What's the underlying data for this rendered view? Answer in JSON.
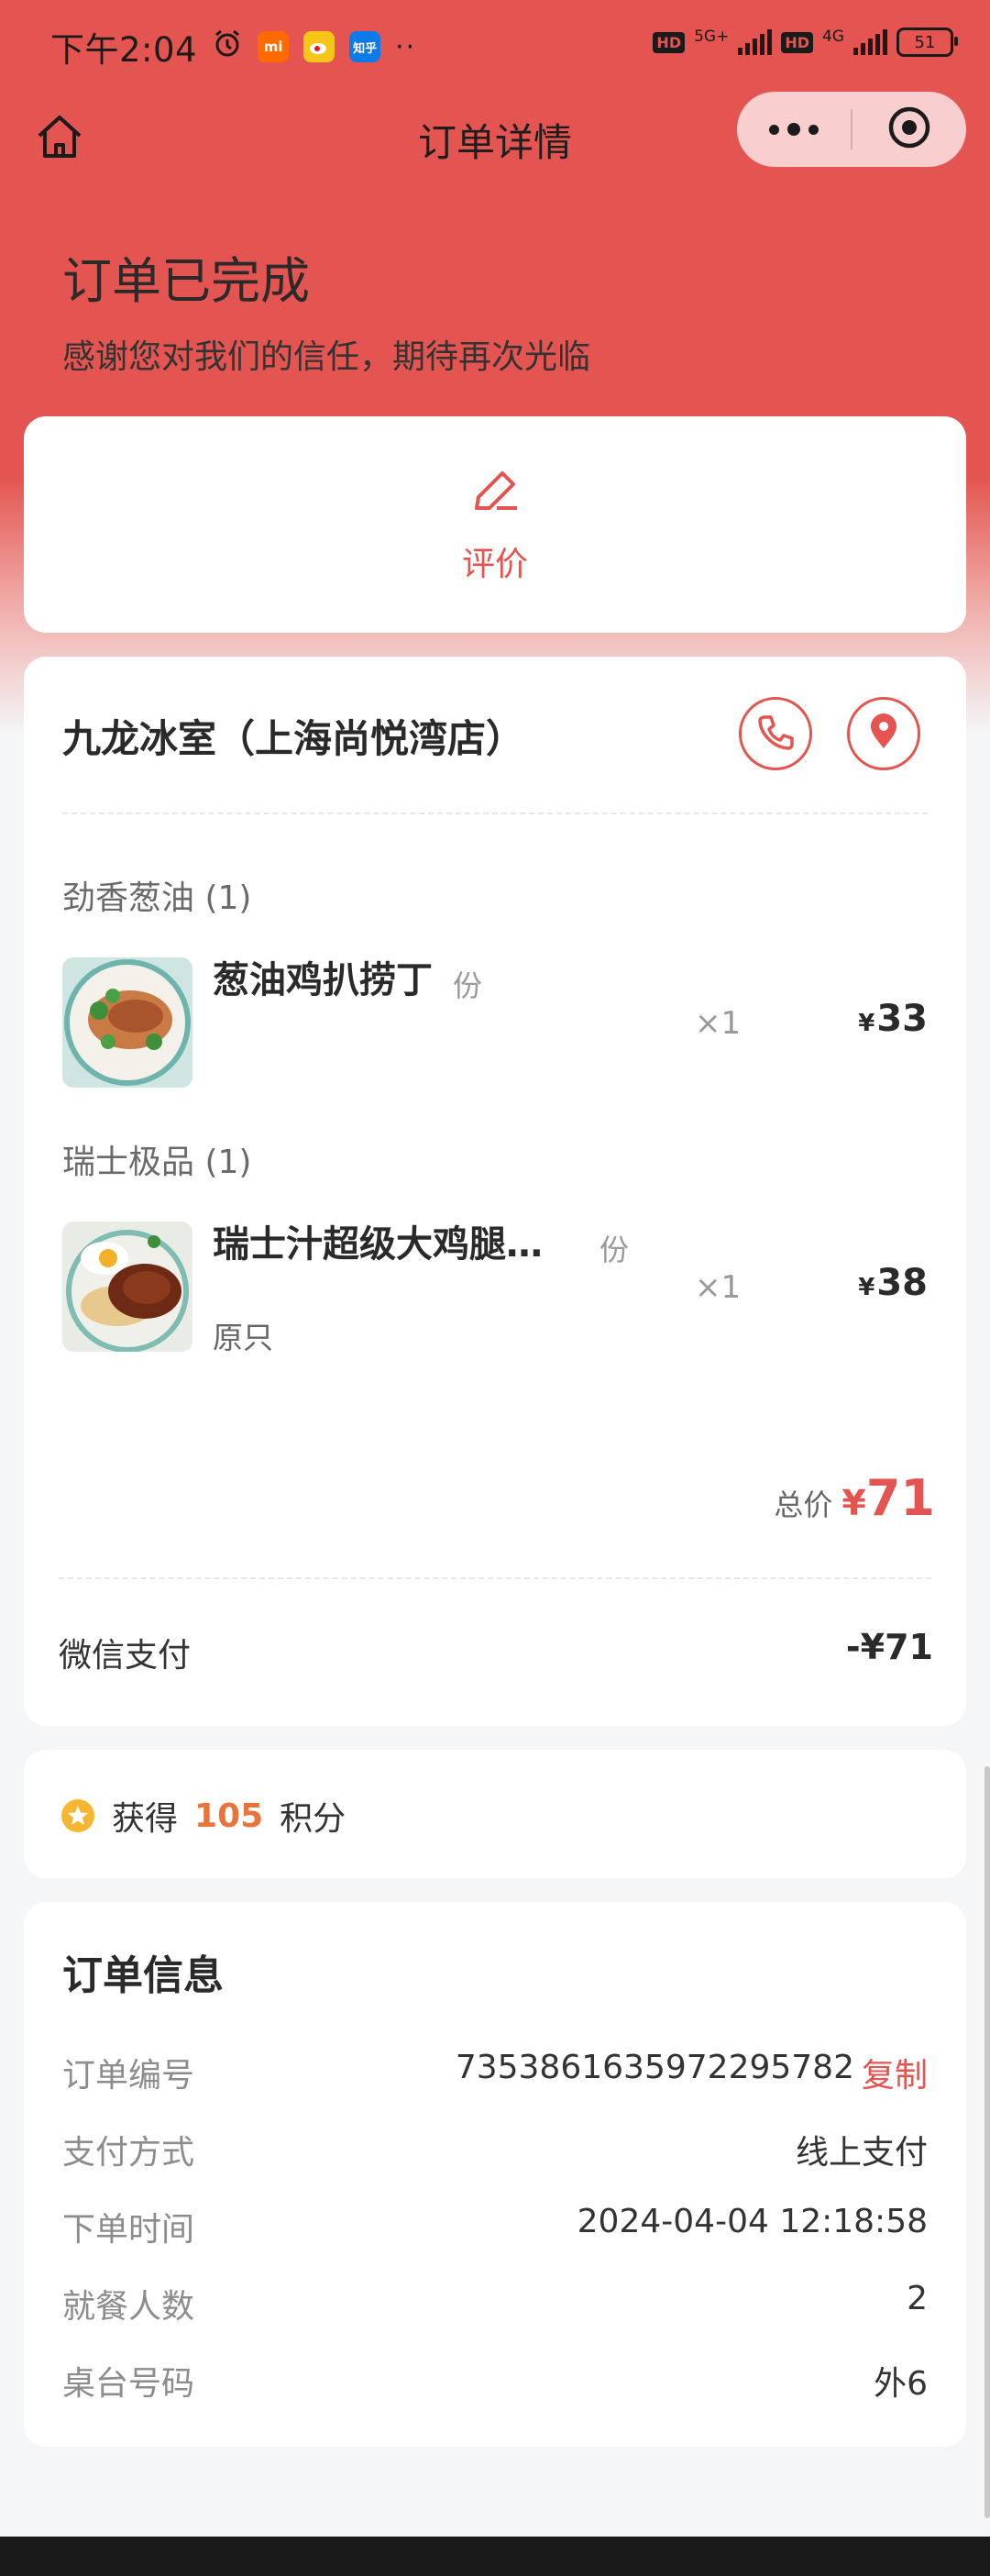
{
  "status_bar": {
    "time": "下午2:04",
    "network_1": "5G+",
    "network_2": "4G",
    "battery": "51",
    "hd_label": "HD",
    "apps": [
      "alarm-icon",
      "mi-app-icon",
      "weibo-app-icon",
      "zhihu-app-icon"
    ],
    "mi_text": "mi",
    "zhihu_text": "知乎"
  },
  "nav": {
    "title": "订单详情"
  },
  "hero": {
    "title": "订单已完成",
    "subtitle": "感谢您对我们的信任，期待再次光临"
  },
  "review": {
    "label": "评价"
  },
  "store": {
    "name": "九龙冰室（上海尚悦湾店）"
  },
  "groups": [
    {
      "title": "劲香葱油 (1)",
      "item": {
        "name": "葱油鸡扒捞丁",
        "unit": "份",
        "spec": "",
        "qty": "×1",
        "currency": "¥",
        "price": "33"
      }
    },
    {
      "title": "瑞士极品 (1)",
      "item": {
        "name": "瑞士汁超级大鸡腿…",
        "unit": "份",
        "spec": "原只",
        "qty": "×1",
        "currency": "¥",
        "price": "38"
      }
    }
  ],
  "total": {
    "label": "总价",
    "currency": "¥",
    "amount": "71"
  },
  "payment": {
    "label": "微信支付",
    "amount": "-¥71"
  },
  "points": {
    "prefix": "获得",
    "value": "105",
    "suffix": "积分"
  },
  "order_info": {
    "title": "订单信息",
    "order_no_label": "订单编号",
    "order_no": "7353861635972295782",
    "copy_label": "复制",
    "pay_method_label": "支付方式",
    "pay_method": "线上支付",
    "order_time_label": "下单时间",
    "order_time": "2024-04-04 12:18:58",
    "diners_label": "就餐人数",
    "diners": "2",
    "table_label": "桌台号码",
    "table": "外6"
  },
  "colors": {
    "brand": "#e45450",
    "points": "#e8743b",
    "star": "#f5b731"
  }
}
